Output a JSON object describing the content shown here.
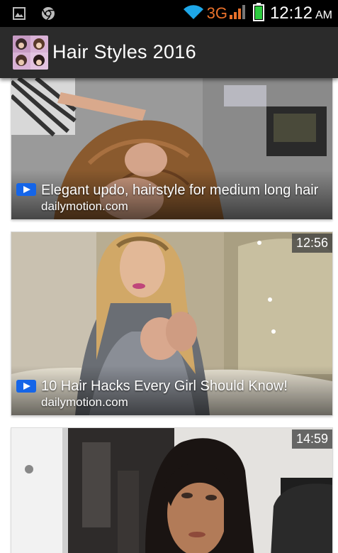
{
  "status_bar": {
    "network": "3G",
    "time": "12:12",
    "ampm": "AM",
    "network_color": "#e8702a",
    "battery_color": "#2ecc40"
  },
  "app_bar": {
    "title": "Hair Styles 2016",
    "background": "#2b2b2b"
  },
  "videos": [
    {
      "title": "Elegant updo, hairstyle for medium long hair",
      "source": "dailymotion.com",
      "duration": ""
    },
    {
      "title": "10 Hair Hacks Every Girl Should Know!",
      "source": "dailymotion.com",
      "duration": "12:56"
    },
    {
      "title": "",
      "source": "",
      "duration": "14:59"
    }
  ]
}
